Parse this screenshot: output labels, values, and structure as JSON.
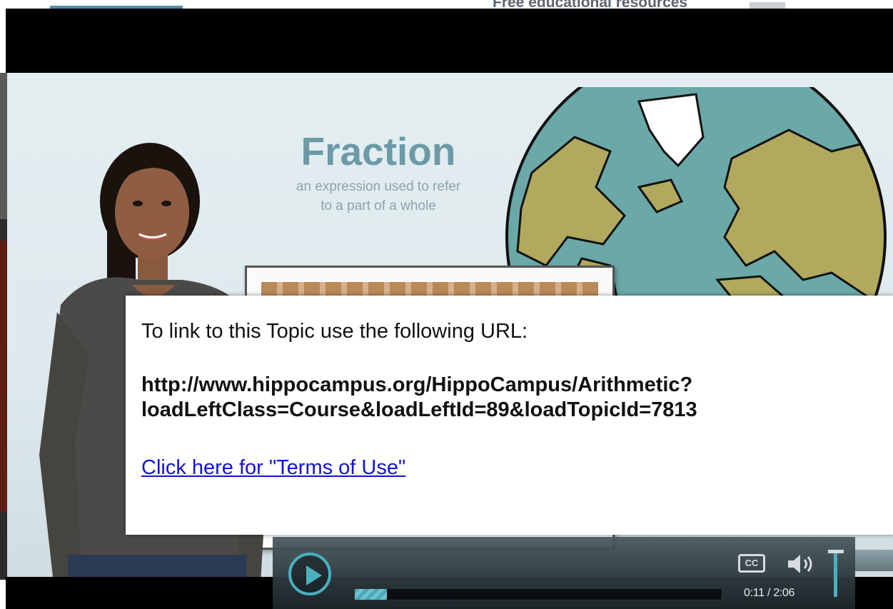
{
  "page_header": {
    "text": "Free educational resources"
  },
  "slide": {
    "title": "Fraction",
    "subtitle_line1": "an expression used to refer",
    "subtitle_line2": "to a part of a whole"
  },
  "share_popup": {
    "instructions": "To link to this Topic use the following URL:",
    "url_line1": "http://www.hippocampus.org/HippoCampus/Arithmetic?",
    "url_line2": "loadLeftClass=Course&loadLeftId=89&loadTopicId=7813",
    "terms_link": "Click here for \"Terms of Use\""
  },
  "controls": {
    "cc_label": "CC",
    "time_current": "0:11",
    "time_total": "2:06",
    "time_display": "0:11 / 2:06",
    "progress_fraction": 0.087,
    "volume_fraction": 1.0,
    "icons": [
      "play-icon",
      "closed-captions-icon",
      "volume-icon"
    ]
  },
  "colors": {
    "accent": "#4ab0bf",
    "title": "#6c9aa6",
    "link": "#1212dd",
    "globe_ocean": "#6aa9a7",
    "globe_land": "#b0a95e"
  }
}
